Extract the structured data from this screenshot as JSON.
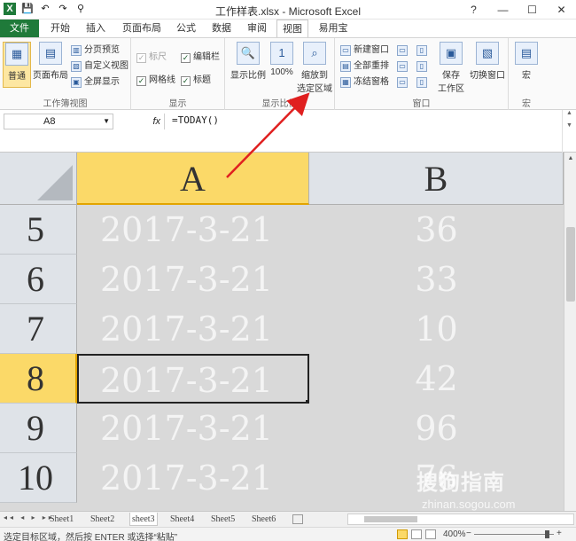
{
  "window": {
    "title": "工作样表.xlsx - Microsoft Excel",
    "controls": {
      "help": "?",
      "minimize": "—",
      "maximize": "☐",
      "close": "✕"
    }
  },
  "qat": {
    "save": "💾",
    "undo": "↶",
    "redo": "↷",
    "custom": "⚲"
  },
  "tabs": [
    {
      "label": "文件"
    },
    {
      "label": "开始"
    },
    {
      "label": "插入"
    },
    {
      "label": "页面布局"
    },
    {
      "label": "公式"
    },
    {
      "label": "数据"
    },
    {
      "label": "审阅"
    },
    {
      "label": "视图"
    },
    {
      "label": "易用宝"
    }
  ],
  "ribbon": {
    "workbook_views": {
      "label": "工作簿视图",
      "normal": "普通",
      "page_layout": "页面布局",
      "page_break": "分页预览",
      "custom_views": "自定义视图",
      "full_screen": "全屏显示"
    },
    "show": {
      "label": "显示",
      "ruler": "标尺",
      "gridlines": "网格线",
      "formula_bar": "编辑栏",
      "headings": "标题"
    },
    "zoom": {
      "label": "显示比例",
      "zoom": "显示比例",
      "hundred": "100%",
      "zoom_selection_1": "缩放到",
      "zoom_selection_2": "选定区域"
    },
    "window": {
      "label": "窗口",
      "new_window": "新建窗口",
      "arrange_all": "全部重排",
      "freeze_panes": "冻结窗格",
      "save_workspace_1": "保存",
      "save_workspace_2": "工作区",
      "switch_windows": "切换窗口"
    },
    "macros": {
      "label": "宏",
      "macros": "宏"
    }
  },
  "formula_bar": {
    "name_box": "A8",
    "fx": "fx",
    "formula": "=TODAY()"
  },
  "grid": {
    "columns": [
      "A",
      "B"
    ],
    "selected_column": "A",
    "selected_row": "8",
    "rows": [
      {
        "num": "5",
        "a": "2017-3-21",
        "b": "36"
      },
      {
        "num": "6",
        "a": "2017-3-21",
        "b": "33"
      },
      {
        "num": "7",
        "a": "2017-3-21",
        "b": "10"
      },
      {
        "num": "8",
        "a": "2017-3-21",
        "b": "42"
      },
      {
        "num": "9",
        "a": "2017-3-21",
        "b": "96"
      },
      {
        "num": "10",
        "a": "2017-3-21",
        "b": "76"
      }
    ]
  },
  "sheets": {
    "nav": "◂◂ ◂ ▸ ▸▸",
    "tabs": [
      "Sheet1",
      "Sheet2",
      "sheet3",
      "Sheet4",
      "Sheet5",
      "Sheet6"
    ],
    "active": "sheet3"
  },
  "status": {
    "message": "选定目标区域，然后按 ENTER 或选择“粘贴”",
    "zoom": "400%",
    "minus": "−",
    "plus": "+"
  },
  "watermark": {
    "brand": "搜狗指南",
    "url": "zhinan.sogou.com"
  },
  "colors": {
    "file_tab": "#1f7a3a",
    "selection": "#fbd968",
    "grid_fill": "#d9d9d9",
    "arrow": "#e02020"
  }
}
